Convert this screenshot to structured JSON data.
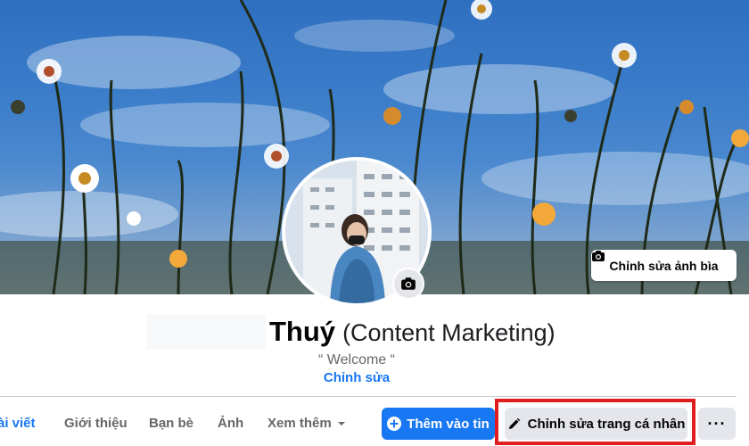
{
  "cover": {
    "edit_cover_label": "Chỉnh sửa ảnh bìa"
  },
  "profile": {
    "name": "Thuý",
    "role": "(Content Marketing)",
    "bio": "“ Welcome “",
    "bio_edit_label": "Chỉnh sửa"
  },
  "tabs": [
    {
      "label": "ài viết",
      "active": true
    },
    {
      "label": "Giới thiệu"
    },
    {
      "label": "Bạn bè"
    },
    {
      "label": "Ảnh"
    },
    {
      "label": "Xem thêm"
    }
  ],
  "actions": {
    "add_story": "Thêm vào tin",
    "edit_profile": "Chỉnh sửa trang cá nhân",
    "more": "···"
  },
  "colors": {
    "accent": "#1877f2",
    "highlight": "#e01e1e",
    "button_gray": "#e4e6eb"
  }
}
